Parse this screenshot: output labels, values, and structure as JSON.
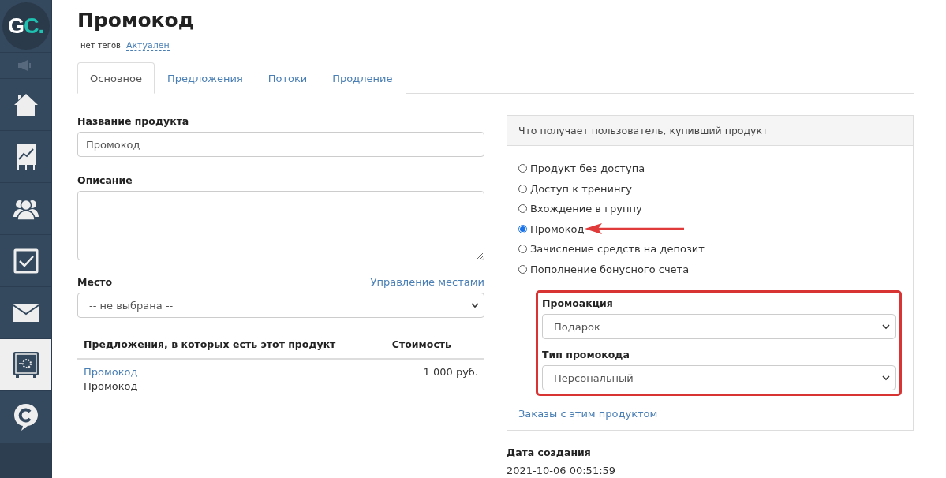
{
  "logo": {
    "first": "G",
    "second": "C."
  },
  "sidebar": {
    "items": [
      {
        "selected": false
      },
      {
        "selected": false
      },
      {
        "selected": false
      },
      {
        "selected": false
      },
      {
        "selected": false
      },
      {
        "selected": true
      },
      {
        "selected": false
      }
    ]
  },
  "page": {
    "title": "Промокод",
    "tags_label": "нет тегов",
    "status_link": "Актуален"
  },
  "tabs": [
    {
      "label": "Основное",
      "selected": true
    },
    {
      "label": "Предложения",
      "selected": false
    },
    {
      "label": "Потоки",
      "selected": false
    },
    {
      "label": "Продление",
      "selected": false
    }
  ],
  "form": {
    "name_label": "Название продукта",
    "name_value": "Промокод",
    "description_label": "Описание",
    "place_label": "Место",
    "place_link": "Управление местами",
    "place_value": "-- не выбрана --"
  },
  "offers_table": {
    "columns": [
      "Предложения, в которых есть этот продукт",
      "Стоимость"
    ],
    "rows": [
      {
        "link": "Промокод",
        "name": "Промокод",
        "price": "1 000 руб."
      }
    ]
  },
  "access_panel": {
    "title": "Что получает пользователь, купивший продукт",
    "options": [
      {
        "label": "Продукт без доступа",
        "selected": false
      },
      {
        "label": "Доступ к тренингу",
        "selected": false
      },
      {
        "label": "Вхождение в группу",
        "selected": false
      },
      {
        "label": "Промокод",
        "selected": true
      },
      {
        "label": "Зачисление средств на депозит",
        "selected": false
      },
      {
        "label": "Пополнение бонусного счета",
        "selected": false
      }
    ],
    "promo_action_label": "Промоакция",
    "promo_action_value": "Подарок",
    "promo_type_label": "Тип промокода",
    "promo_type_value": "Персональный",
    "orders_link": "Заказы с этим продуктом"
  },
  "created": {
    "label": "Дата создания",
    "value": "2021-10-06 00:51:59"
  }
}
